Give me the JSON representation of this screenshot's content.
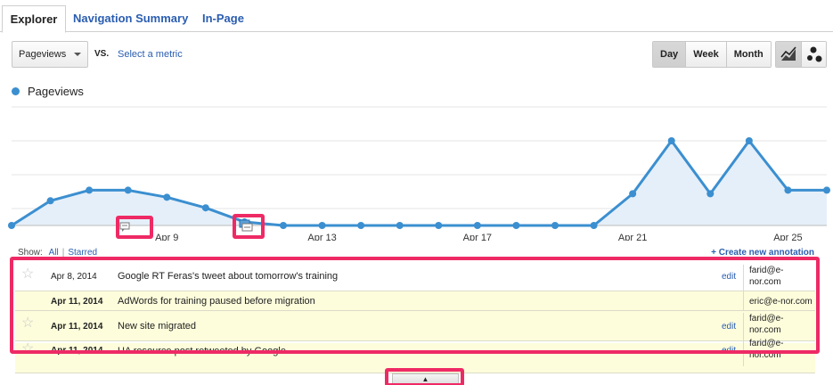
{
  "tabs": [
    {
      "label": "Explorer"
    },
    {
      "label": "Navigation Summary"
    },
    {
      "label": "In-Page"
    }
  ],
  "controls": {
    "metric_selected": "Pageviews",
    "vs_label": "VS.",
    "select_metric_label": "Select a metric",
    "granularity": [
      "Day",
      "Week",
      "Month"
    ],
    "granularity_selected": "Day"
  },
  "legend": {
    "series_name": "Pageviews",
    "color": "#3b8fd0"
  },
  "chart_data": {
    "type": "area",
    "x_tick_labels": [
      "Apr 9",
      "Apr 13",
      "Apr 17",
      "Apr 21",
      "Apr 25"
    ],
    "x": [
      "Apr 5",
      "Apr 6",
      "Apr 7",
      "Apr 8",
      "Apr 9",
      "Apr 10",
      "Apr 11",
      "Apr 12",
      "Apr 13",
      "Apr 14",
      "Apr 15",
      "Apr 16",
      "Apr 17",
      "Apr 18",
      "Apr 19",
      "Apr 20",
      "Apr 21",
      "Apr 22",
      "Apr 23",
      "Apr 24",
      "Apr 25",
      "Apr 26"
    ],
    "series": [
      {
        "name": "Pageviews",
        "values": [
          0,
          0.7,
          1.0,
          1.0,
          0.8,
          0.5,
          0.1,
          0,
          0,
          0,
          0,
          0,
          0,
          0,
          0,
          0,
          0.9,
          2.4,
          0.9,
          2.4,
          1.0,
          1.0
        ]
      }
    ],
    "line_color": "#3b8fd0",
    "fill_color": "#e5eff9",
    "grid": true
  },
  "annotations_bar": {
    "show_label": "Show:",
    "all_label": "All",
    "separator": "|",
    "starred_label": "Starred",
    "create_label": "+ Create new annotation"
  },
  "annotations": [
    {
      "date": "Apr 8, 2014",
      "text": "Google RT Feras's tweet about tomorrow's training",
      "edit": "edit",
      "user": "farid@e-nor.com",
      "starred": false
    },
    {
      "date": "Apr 11, 2014",
      "text": "AdWords for training paused before migration",
      "edit": "",
      "user": "eric@e-nor.com",
      "starred": false
    },
    {
      "date": "Apr 11, 2014",
      "text": "New site migrated",
      "edit": "edit",
      "user": "farid@e-nor.com",
      "starred": false
    },
    {
      "date": "Apr 11, 2014",
      "text": "UA resource post retweeted by Google",
      "edit": "edit",
      "user": "farid@e-nor.com",
      "starred": false
    }
  ],
  "highlight_color": "#ee2a65"
}
